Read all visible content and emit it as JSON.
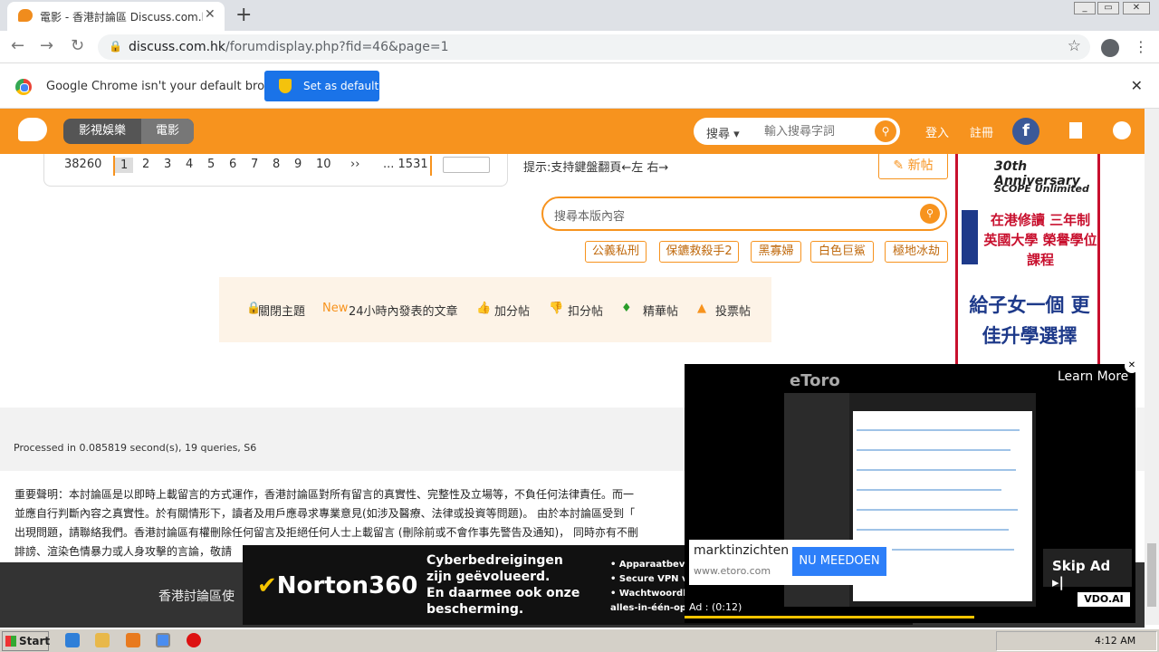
{
  "browser": {
    "tab_title": "電影 - 香港討論區 Discuss.com.hk - ",
    "tab_close": "✕",
    "new_tab": "+",
    "url_domain": "discuss.com.hk",
    "url_path": "/forumdisplay.php?fid=46&page=1",
    "infobar_message": "Google Chrome isn't your default browser",
    "set_default_label": "Set as default"
  },
  "header": {
    "segment_left": "影視娛樂",
    "segment_right": "電影",
    "search_category": "搜尋 ▾",
    "search_placeholder": "輸入搜尋字詞",
    "login": "登入",
    "register": "註冊",
    "facebook": "f"
  },
  "pager": {
    "total": "38260",
    "pages": [
      "1",
      "2",
      "3",
      "4",
      "5",
      "6",
      "7",
      "8",
      "9",
      "10"
    ],
    "next": "››",
    "last": "... 1531",
    "current": "1"
  },
  "hint": "提示:支持鍵盤翻頁←左 右→",
  "new_post": "✎ 新帖",
  "forum_search_placeholder": "搜尋本版內容",
  "tags": [
    "公義私刑",
    "保鑣救殺手2",
    "黑寡婦",
    "白色巨鯊",
    "極地冰劫"
  ],
  "filters": {
    "closed": "關閉主題",
    "new_badge": "New",
    "recent": "24小時內發表的文章",
    "plus": "加分帖",
    "minus": "扣分帖",
    "digest": "精華帖",
    "poll": "投票帖"
  },
  "side_ad": {
    "anniv": "30th Anniversary",
    "brand": "SCOPE Unlimited",
    "line1": "在港修讀 三年制 英國大學 榮譽學位課程",
    "line2": "給子女一個 更佳升學選擇"
  },
  "footer": {
    "processed": "Processed in 0.085819 second(s), 19 queries, S6",
    "disclaimer_1": "重要聲明：本討論區是以即時上載留言的方式運作，香港討論區對所有留言的真實性、完整性及立場等，不負任何法律責任。而一",
    "disclaimer_2": "並應自行判斷內容之真實性。於有關情形下，讀者及用戶應尋求專業意見(如涉及醫療、法律或投資等問題)。 由於本討論區受到「",
    "disclaimer_3": "出現問題，請聯絡我們。香港討論區有權刪除任何留言及拒絕任何人士上載留言 (刪除前或不會作事先警告及通知)， 同時亦有不刪",
    "disclaimer_4": "誹謗、渲染色情暴力或人身攻擊的言論，敬請",
    "dark_text": "香港討論區使"
  },
  "norton_ad": {
    "logo": "Norton360",
    "copy_1": "Cyberbedreigingen",
    "copy_2": "zijn geëvolueerd.",
    "copy_3": "En daarmee ook onze",
    "copy_4": "bescherming.",
    "bullet_1": "• Apparaatbeveili",
    "bullet_2": "• Secure VPN voo",
    "bullet_3": "• Wachtwoordbel",
    "bullet_4": "alles-in-één-opl"
  },
  "video_ad": {
    "brand": "eToro",
    "learn_more": "Learn More",
    "advertiser": "marktinzichten",
    "advertiser_url": "www.etoro.com",
    "cta": "NU MEEDOEN",
    "ad_time": "Ad : (0:12)",
    "skip": "Skip Ad ▸|",
    "vdo": "VDO.AI"
  },
  "taskbar": {
    "start": "Start",
    "time": "4:12 AM"
  }
}
